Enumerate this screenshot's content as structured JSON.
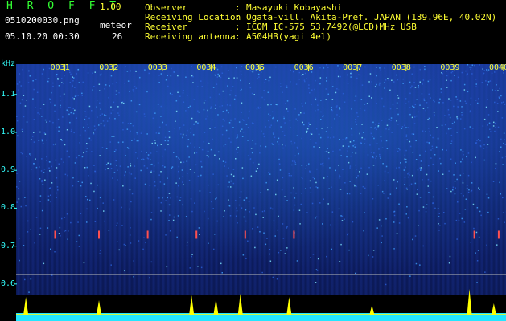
{
  "header": {
    "app_title": "H R O F F T",
    "app_version": "1.00",
    "file_name": "0510200030.png",
    "datetime": "05.10.20 00:30",
    "meteor_label": "meteor",
    "meteor_count": "26"
  },
  "station": [
    {
      "label": "Observer",
      "value": "Masayuki Kobayashi"
    },
    {
      "label": "Receiving Location",
      "value": "Ogata-vill. Akita-Pref. JAPAN (139.96E, 40.02N)"
    },
    {
      "label": "Receiver",
      "value": "ICOM IC-575 53.7492(@LCD)MHz USB"
    },
    {
      "label": "Receiving antenna",
      "value": "A504HB(yagi 4el)"
    }
  ],
  "colors": {
    "text_green": "#33ff33",
    "text_yellow": "#ffff33",
    "text_cyan": "#33ffff",
    "spectrogram_bg": "#122a80",
    "echo_trace": "#ffff00"
  },
  "axis": {
    "unit": "kHz",
    "freq_ticks": [
      "1.1",
      "1.0",
      "0.9",
      "0.8",
      "0.7",
      "0.6"
    ],
    "minute_labels": [
      "0031",
      "0032",
      "0033",
      "0034",
      "0035",
      "0036",
      "0037",
      "0038",
      "0039",
      "0040"
    ]
  },
  "chart_data": {
    "type": "heatmap",
    "title": "",
    "xlabel": "",
    "ylabel": "kHz",
    "ylim": [
      0.57,
      1.18
    ],
    "x_ticks": [
      "0031",
      "0032",
      "0033",
      "0034",
      "0035",
      "0036",
      "0037",
      "0038",
      "0039",
      "0040"
    ],
    "y_ticks": [
      1.1,
      1.0,
      0.9,
      0.8,
      0.7,
      0.6
    ],
    "echo_freq_khz": 0.73,
    "echo_minutes": [
      30.8,
      31.7,
      32.7,
      33.7,
      34.7,
      35.7,
      39.4,
      39.9
    ],
    "trace_peaks": [
      {
        "minute": 30.2,
        "level": 0.55
      },
      {
        "minute": 31.7,
        "level": 0.45
      },
      {
        "minute": 33.6,
        "level": 0.6
      },
      {
        "minute": 34.1,
        "level": 0.5
      },
      {
        "minute": 34.6,
        "level": 0.65
      },
      {
        "minute": 35.6,
        "level": 0.55
      },
      {
        "minute": 37.3,
        "level": 0.3
      },
      {
        "minute": 39.3,
        "level": 0.8
      },
      {
        "minute": 39.8,
        "level": 0.35
      }
    ],
    "grid": true
  }
}
